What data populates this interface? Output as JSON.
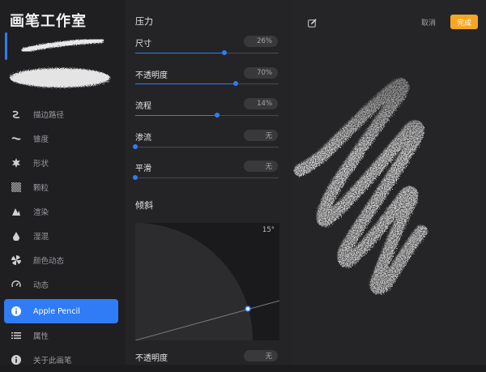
{
  "app": {
    "title": "画笔工作室"
  },
  "sidebar": {
    "items": [
      {
        "label": "描边路径",
        "icon": "stroke-path-icon",
        "active": false
      },
      {
        "label": "锥度",
        "icon": "taper-icon",
        "active": false
      },
      {
        "label": "形状",
        "icon": "shape-icon",
        "active": false
      },
      {
        "label": "颗粒",
        "icon": "grain-icon",
        "active": false
      },
      {
        "label": "渲染",
        "icon": "rendering-icon",
        "active": false
      },
      {
        "label": "湿混",
        "icon": "wet-mix-icon",
        "active": false
      },
      {
        "label": "颜色动态",
        "icon": "color-dynamics-icon",
        "active": false
      },
      {
        "label": "动态",
        "icon": "dynamics-icon",
        "active": false
      },
      {
        "label": "Apple Pencil",
        "icon": "info-icon",
        "active": true
      },
      {
        "label": "属性",
        "icon": "properties-icon",
        "active": false
      },
      {
        "label": "关于此画笔",
        "icon": "info-icon",
        "active": false
      }
    ]
  },
  "panel": {
    "pressure_title": "压力",
    "rows": [
      {
        "label": "尺寸",
        "value": "26%",
        "level": 0.62
      },
      {
        "label": "不透明度",
        "value": "70%",
        "level": 0.7
      },
      {
        "label": "流程",
        "value": "14%",
        "level": 0.57
      },
      {
        "label": "渗流",
        "value": "无",
        "level": 0.0
      },
      {
        "label": "平滑",
        "value": "无",
        "level": 0.0
      }
    ],
    "tilt_title": "倾斜",
    "tilt_angle": "15°",
    "bottom_row": {
      "label": "不透明度",
      "value": "无"
    }
  },
  "canvas": {
    "cancel_label": "取消",
    "done_label": "完成",
    "accent": "#f5a623"
  },
  "colors": {
    "accent": "#2f7cf6"
  }
}
